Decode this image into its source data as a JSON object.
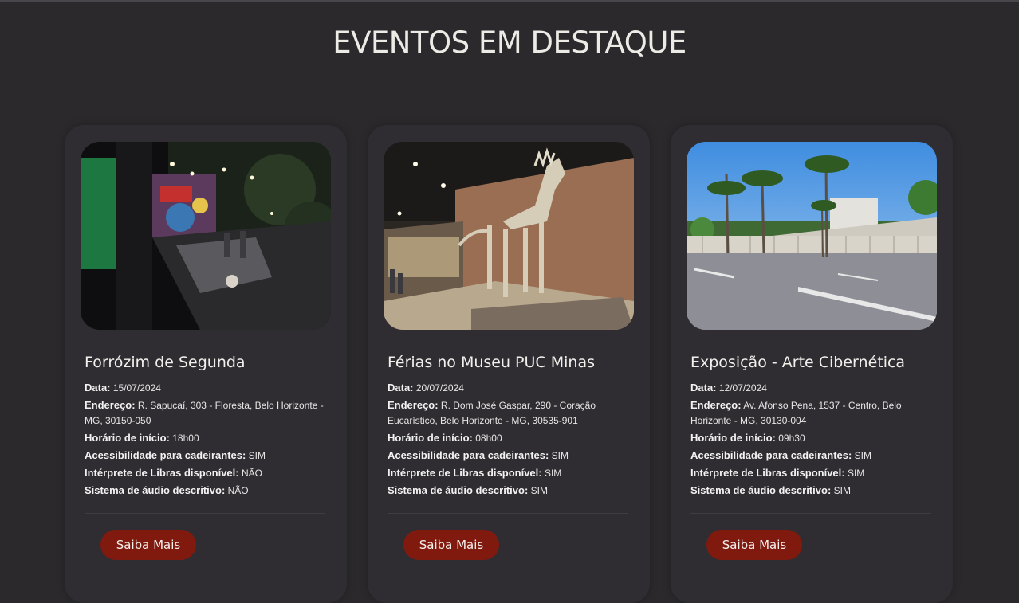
{
  "page": {
    "title": "EVENTOS EM DESTAQUE"
  },
  "colors": {
    "background": "#2b292c",
    "card": "#2f2d31",
    "button": "#801a0f",
    "text": "#eeeeee"
  },
  "labels": {
    "date": "Data:",
    "address": "Endereço:",
    "start_time": "Horário de início:",
    "wheelchair": "Acessibilidade para cadeirantes:",
    "libras": "Intérprete de Libras disponível:",
    "audio": "Sistema de áudio descritivo:",
    "button": "Saiba Mais"
  },
  "events": [
    {
      "title": "Forrózim de Segunda",
      "image": "night-party-courtyard-photo",
      "date": "15/07/2024",
      "address": "R. Sapucaí, 303 - Floresta, Belo Horizonte - MG, 30150-050",
      "start_time": "18h00",
      "wheelchair": "SIM",
      "libras": "NÃO",
      "audio": "NÃO"
    },
    {
      "title": "Férias no Museu PUC Minas",
      "image": "dinosaur-skeleton-museum-photo",
      "date": "20/07/2024",
      "address": "R. Dom José Gaspar, 290 - Coração Eucarístico, Belo Horizonte - MG, 30535-901",
      "start_time": "08h00",
      "wheelchair": "SIM",
      "libras": "SIM",
      "audio": "SIM"
    },
    {
      "title": "Exposição - Arte Cibernética",
      "image": "palm-trees-avenue-building-photo",
      "date": "12/07/2024",
      "address": "Av. Afonso Pena, 1537 - Centro, Belo Horizonte - MG, 30130-004",
      "start_time": "09h30",
      "wheelchair": "SIM",
      "libras": "SIM",
      "audio": "SIM"
    }
  ]
}
